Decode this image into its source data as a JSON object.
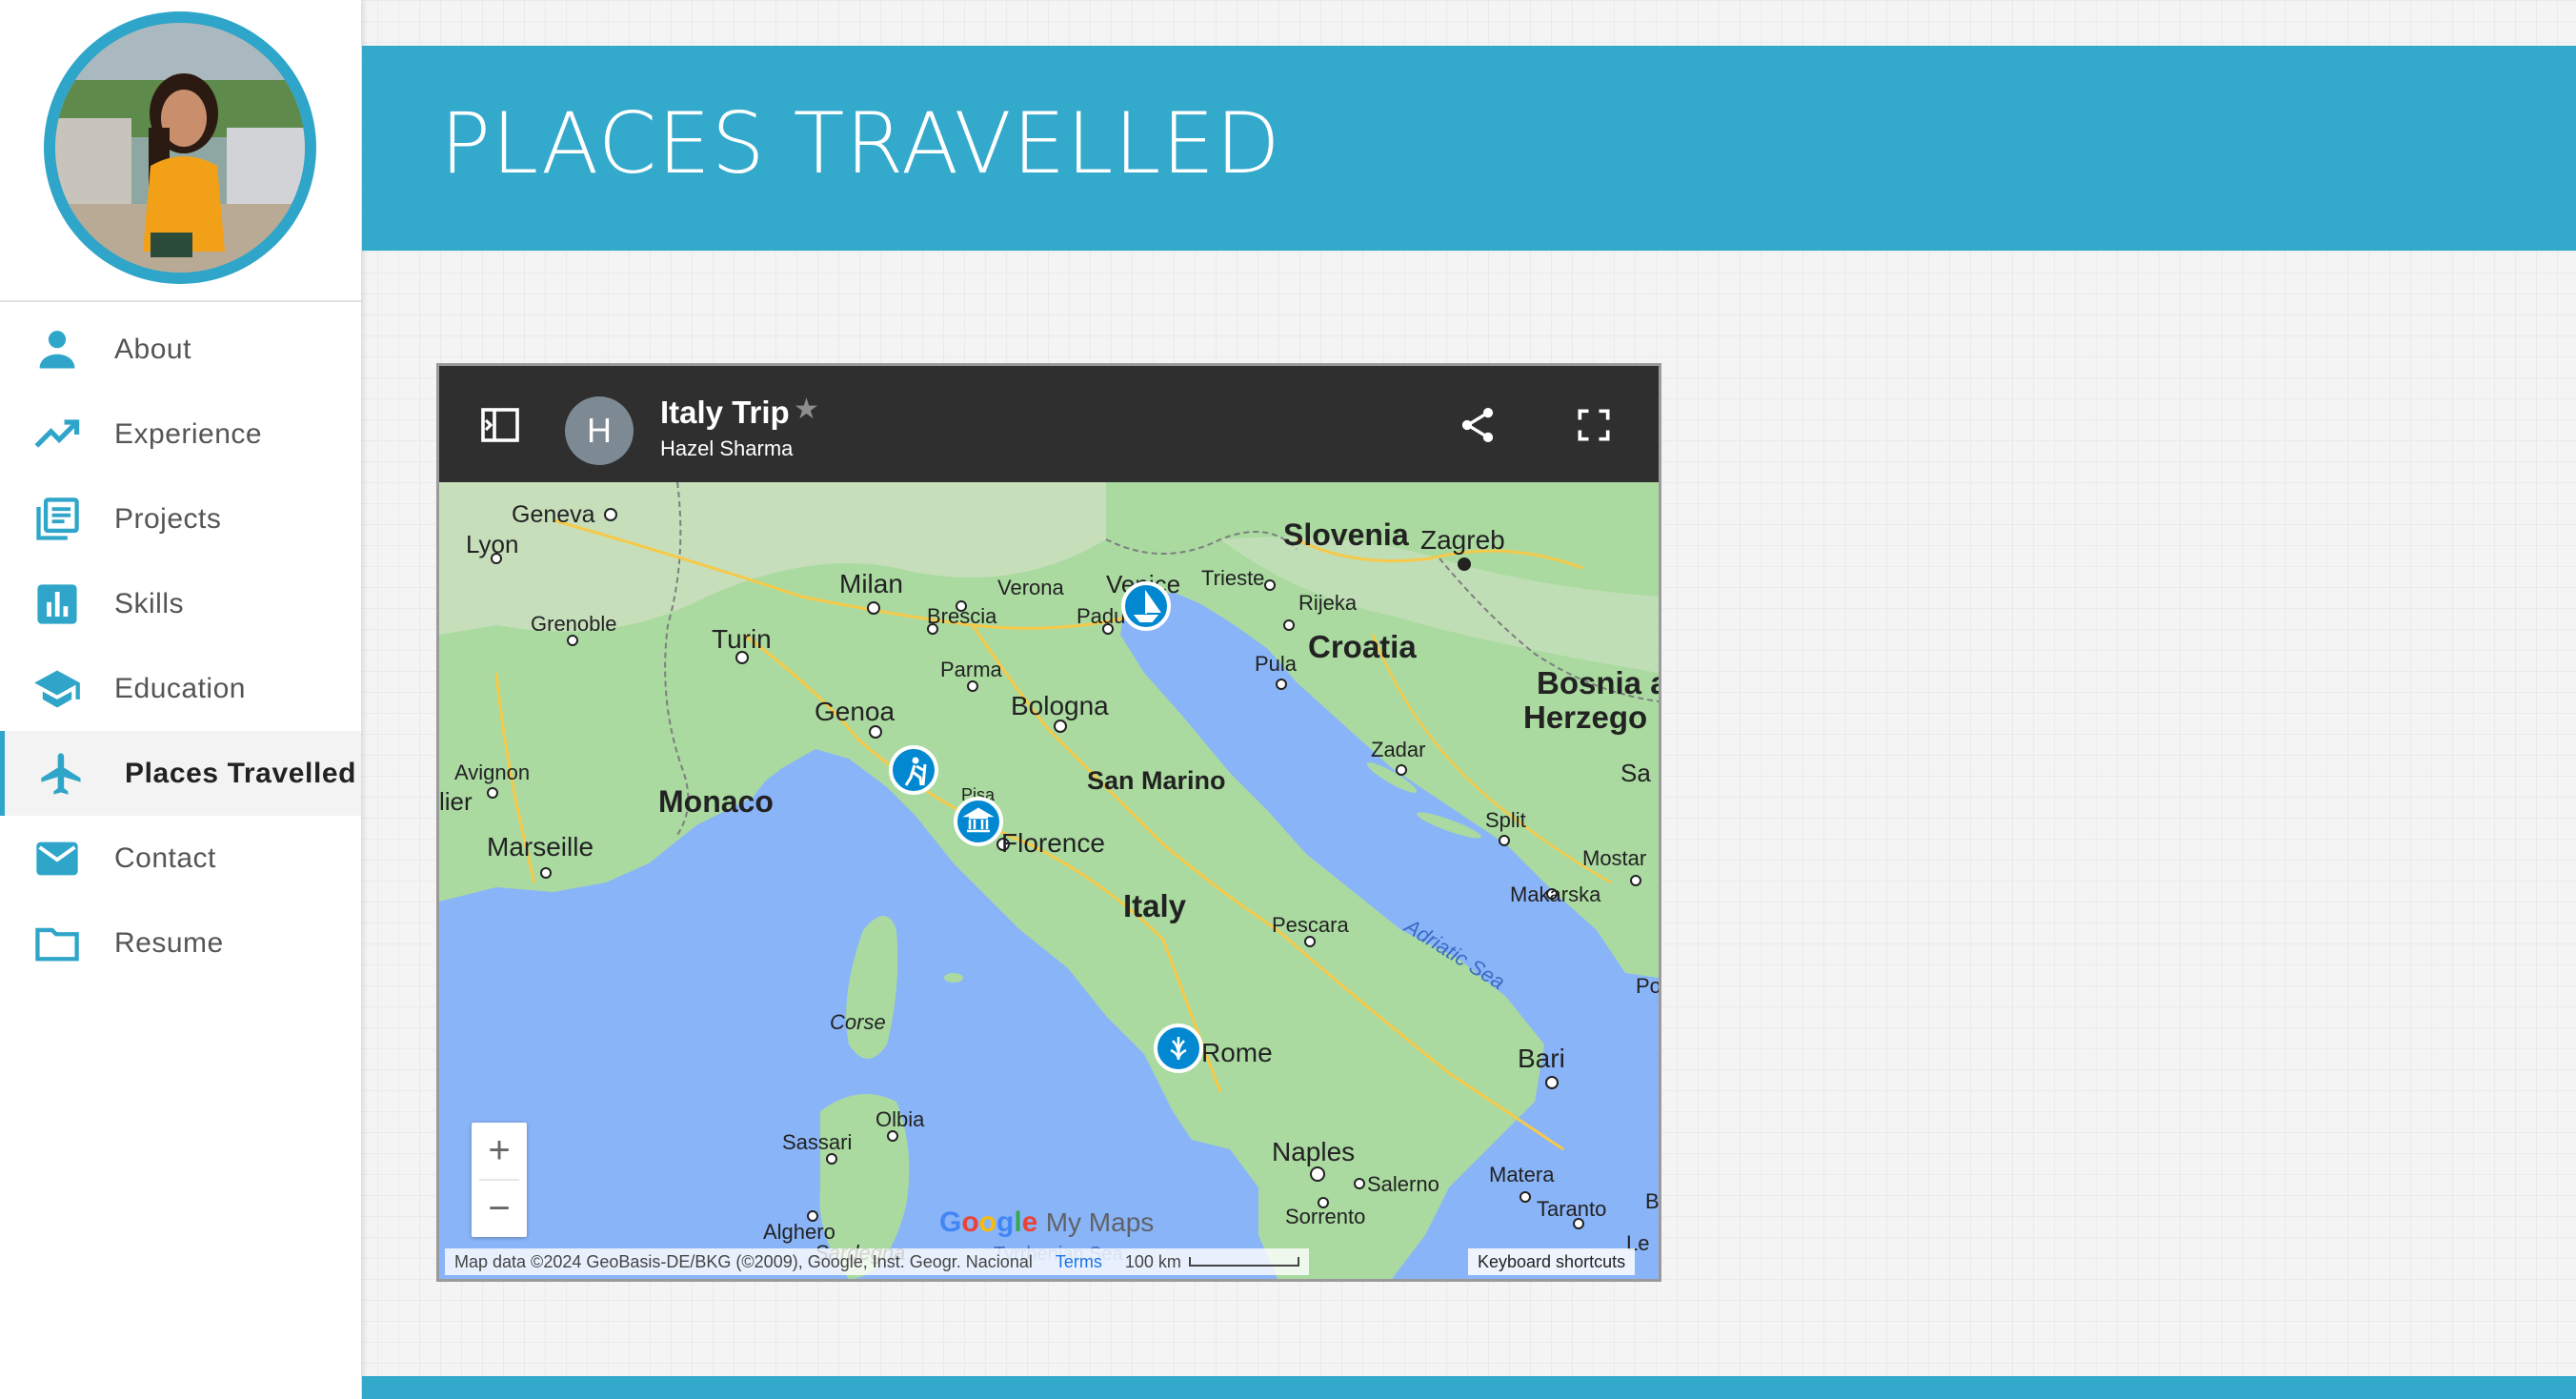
{
  "sidebar": {
    "items": [
      {
        "label": "About",
        "icon": "person-icon"
      },
      {
        "label": "Experience",
        "icon": "trending-up-icon"
      },
      {
        "label": "Projects",
        "icon": "document-list-icon"
      },
      {
        "label": "Skills",
        "icon": "bar-chart-icon"
      },
      {
        "label": "Education",
        "icon": "graduation-cap-icon"
      },
      {
        "label": "Places Travelled",
        "icon": "airplane-icon",
        "active": true
      },
      {
        "label": "Contact",
        "icon": "mail-icon"
      },
      {
        "label": "Resume",
        "icon": "folder-icon"
      }
    ]
  },
  "header": {
    "title": "PLACES TRAVELLED"
  },
  "map": {
    "title": "Italy Trip",
    "author": "Hazel Sharma",
    "owner_initial": "H",
    "labels": {
      "countries": [
        "Slovenia",
        "Croatia",
        "Bosnia a",
        "Herzego",
        "San Marino",
        "Italy",
        "Monaco"
      ],
      "cities": [
        "Geneva",
        "Lyon",
        "Milan",
        "Verona",
        "Venice",
        "Trieste",
        "Zagreb",
        "Grenoble",
        "Turin",
        "Brescia",
        "Padua",
        "Rijeka",
        "Pula",
        "Parma",
        "Genoa",
        "Bologna",
        "Avignon",
        "Zadar",
        "Split",
        "Sa",
        "Marseille",
        "Florence",
        "Mostar",
        "Makarska",
        "Pescara",
        "Corse",
        "Rome",
        "Bari",
        "Olbia",
        "Sassari",
        "Naples",
        "Salerno",
        "Matera",
        "Taranto",
        "Sorrento",
        "Alghero",
        "Sardegna",
        "Tyrrhenian Sea",
        "Le",
        "lier",
        "Pisa",
        "Po",
        "B"
      ],
      "sea": "Adriatic Sea"
    },
    "markers": [
      "sailboat-marker",
      "hiking-marker",
      "museum-marker",
      "restaurant-marker"
    ],
    "zoom_in": "+",
    "zoom_out": "−",
    "attribution": "Map data ©2024 GeoBasis-DE/BKG (©2009), Google, Inst. Geogr. Nacional",
    "terms": "Terms",
    "scale": "100 km",
    "keyboard": "Keyboard shortcuts",
    "logo_google": "Google",
    "logo_mymaps": "My Maps"
  },
  "colors": {
    "accent": "#33a9cc",
    "water": "#8ab4f8",
    "land": "#aadaa0",
    "map_bar": "#2f2f2f"
  }
}
